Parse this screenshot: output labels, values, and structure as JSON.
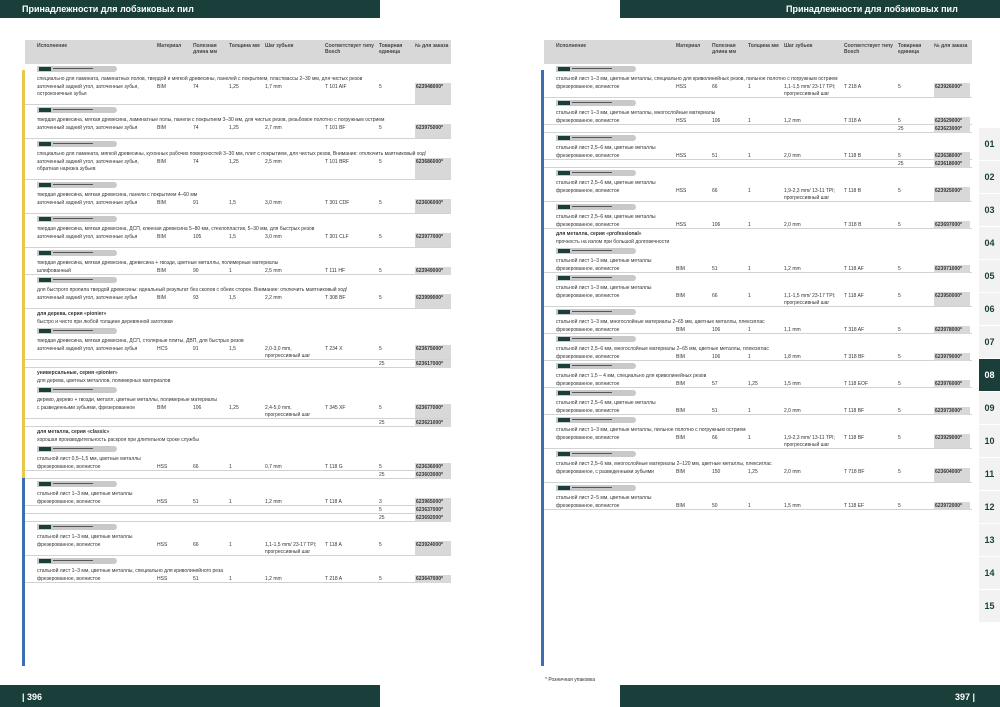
{
  "left": {
    "title": "Принадлежности для лобзиковых пил",
    "page_number": "| 396",
    "headers": [
      "Исполнение",
      "Материал",
      "Полезная длина мм",
      "Толщина мм",
      "Шаг зубьев",
      "Соответствует типу Bosch",
      "Товарная единица",
      "№ для заказа"
    ],
    "sections": [
      {
        "category": "",
        "desc": [
          "специально для ламината, ламинатных полов, твердой и мягкой древесины, панелей с покрытием, пластмассы 2–30 мм, для чистых резов"
        ],
        "rows": [
          [
            "заточенный задний угол, заточенные зубья, остроконечные зубья",
            "BIM",
            "74",
            "1,25",
            "1,7 mm",
            "T 101 AIF",
            "5",
            "623948000*"
          ]
        ]
      },
      {
        "category": "",
        "desc": [
          "твердая древесина, мягкая древесина, ламинатные полы, панели с покрытием 3–30 мм, для чистых резов, резьбовое полотно с погружным острием"
        ],
        "rows": [
          [
            "заточенный задний угол, заточенные зубья",
            "BIM",
            "74",
            "1,25",
            "2,7 mm",
            "T 101 BF",
            "5",
            "623975000*"
          ]
        ]
      },
      {
        "category": "",
        "desc": [
          "специально для ламината, мягкой древесины, кухонных рабочих поверхностей 3–30 мм, плит с покрытием, для чистых резов, Внимание: отключить маятниковый ход!"
        ],
        "rows": [
          [
            "заточенный задний угол, заточенные зубья, обратная нарезка зубьев",
            "BIM",
            "74",
            "1,25",
            "2,5 mm",
            "T 101 BRF",
            "5",
            "623686000*"
          ]
        ]
      },
      {
        "category": "",
        "desc": [
          "твердая древесина, мягкая древесина, панели с покрытием 4–60 мм"
        ],
        "rows": [
          [
            "заточенный задний угол, заточенные зубья",
            "BIM",
            "91",
            "1,5",
            "3,0 mm",
            "T 301 CDF",
            "5",
            "623606000*"
          ]
        ]
      },
      {
        "category": "",
        "desc": [
          "твердая древесина, мягкая древесина, ДСП, клееная древесина 5–80 мм, стеклопластик, 5–30 мм, для быстрых резов"
        ],
        "rows": [
          [
            "заточенный задний угол, заточенные зубья",
            "BIM",
            "105",
            "1,5",
            "3,0 mm",
            "T 301 CLF",
            "5",
            "623977000*"
          ]
        ]
      },
      {
        "category": "",
        "desc": [
          "твердая древесина, мягкая древесина, древесина + гвозди, цветные металлы, полимерные материалы"
        ],
        "rows": [
          [
            "шлифованный",
            "BIM",
            "90",
            "1",
            "2,5 mm",
            "T 111 HF",
            "5",
            "623949000*"
          ]
        ]
      },
      {
        "category": "",
        "desc": [
          "для быстрого пропила твердой древесины: идеальный результат без сколов с обеих сторон. Внимание: отключить маятниковый ход!"
        ],
        "rows": [
          [
            "заточенный задний угол, заточенные зубья",
            "BIM",
            "93",
            "1,5",
            "2,2 mm",
            "T 308 BF",
            "5",
            "623999000*"
          ]
        ]
      },
      {
        "category": "для дерева, серия «pionier»",
        "sub": "быстро и чисто при любой толщине деревянной заготовки",
        "desc": [
          "твердая древесина, мягкая древесина, ДСП, столярные плиты, ДВП, для быстрых резов"
        ],
        "rows": [
          [
            "заточенный задний угол, заточенные зубья",
            "HCS",
            "91",
            "1,5",
            "2,0-3,0 mm, прогрессивный шаг",
            "T 234 X",
            "5",
            "623675000*"
          ],
          [
            "",
            "",
            "",
            "",
            "",
            "",
            "25",
            "623617000*"
          ]
        ]
      },
      {
        "category": "универсальные, серия «pionier»",
        "sub": "для дерева, цветных металлов, полимерных материалов",
        "desc": [
          "дерево, дерево + гвозди, металл, цветные металлы, полимерные материалы"
        ],
        "rows": [
          [
            "с разведенными зубьями, фрезерованное",
            "BIM",
            "106",
            "1,25",
            "2,4-5,0 mm, прогрессивный шаг",
            "T 345 XF",
            "5",
            "623677000*"
          ],
          [
            "",
            "",
            "",
            "",
            "",
            "",
            "25",
            "623621000*"
          ]
        ]
      },
      {
        "category": "для металла, серия «classic»",
        "sub": "хорошая производительность раскроя при длительном сроке службы",
        "desc": [
          "стальной лист 0,5–1,5 мм, цветные металлы"
        ],
        "rows": [
          [
            "фрезерованное, волнистое",
            "HSS",
            "66",
            "1",
            "0,7 mm",
            "T 118 G",
            "5",
            "623636000*"
          ],
          [
            "",
            "",
            "",
            "",
            "",
            "",
            "25",
            "623603000*"
          ]
        ]
      },
      {
        "category": "",
        "desc": [
          "стальной лист 1–3 мм, цветные металлы"
        ],
        "rows": [
          [
            "фрезерованное, волнистое",
            "HSS",
            "51",
            "1",
            "1,2 mm",
            "T 118 A",
            "3",
            "623965000*"
          ],
          [
            "",
            "",
            "",
            "",
            "",
            "",
            "5",
            "623637000*"
          ],
          [
            "",
            "",
            "",
            "",
            "",
            "",
            "25",
            "623692000*"
          ]
        ]
      },
      {
        "category": "",
        "desc": [
          "стальной лист 1–3 мм, цветные металлы"
        ],
        "rows": [
          [
            "фрезерованное, волнистое",
            "HSS",
            "66",
            "1",
            "1,1-1,5 mm/ 23-17 TPI; прогрессивный шаг",
            "T 118 A",
            "5",
            "623924000*"
          ]
        ]
      },
      {
        "category": "",
        "desc": [
          "стальной лист 1–3 мм, цветные металлы, специально для криволинейного реза"
        ],
        "rows": [
          [
            "фрезерованное, волнистое",
            "HSS",
            "51",
            "1",
            "1,2 mm",
            "T 218 A",
            "5",
            "623647000*"
          ]
        ]
      }
    ]
  },
  "right": {
    "title": "Принадлежности для лобзиковых пил",
    "page_number": "397 |",
    "footnote": "* Розничная упаковка",
    "tabs": [
      "01",
      "02",
      "03",
      "04",
      "05",
      "06",
      "07",
      "08",
      "09",
      "10",
      "11",
      "12",
      "13",
      "14",
      "15"
    ],
    "active_tab": "08",
    "headers": [
      "Исполнение",
      "Материал",
      "Полезная длина мм",
      "Толщина мм",
      "Шаг зубьев",
      "Соответствует типу Bosch",
      "Товарная единица",
      "№ для заказа"
    ],
    "sections": [
      {
        "category": "",
        "desc": [
          "стальной лист 1–3 мм, цветные металлы, специально для криволинейных резов, пильное полотно с погружным острием"
        ],
        "rows": [
          [
            "фрезерованное, волнистое",
            "HSS",
            "66",
            "1",
            "1,1-1,5 mm/ 23-17 TPI; прогрессивный шаг",
            "T 218 A",
            "5",
            "623926000*"
          ]
        ]
      },
      {
        "category": "",
        "desc": [
          "стальной лист 1–3 мм, цветные металлы, многослойные материалы"
        ],
        "rows": [
          [
            "фрезерованное, волнистое",
            "HSS",
            "106",
            "1",
            "1,2 mm",
            "T 318 A",
            "5",
            "623629000*"
          ],
          [
            "",
            "",
            "",
            "",
            "",
            "",
            "25",
            "623623000*"
          ]
        ]
      },
      {
        "category": "",
        "desc": [
          "стальной лист 2,5–6 мм, цветные металлы"
        ],
        "rows": [
          [
            "фрезерованное, волнистое",
            "HSS",
            "51",
            "1",
            "2,0 mm",
            "T 118 B",
            "5",
            "623638000*"
          ],
          [
            "",
            "",
            "",
            "",
            "",
            "",
            "25",
            "623618000*"
          ]
        ]
      },
      {
        "category": "",
        "desc": [
          "стальной лист 2,5–6 мм, цветные металлы"
        ],
        "rows": [
          [
            "фрезерованное, волнистое",
            "HSS",
            "66",
            "1",
            "1,9-2,3 mm/ 13-11 TPI; прогрессивный шаг",
            "T 118 B",
            "5",
            "623925000*"
          ]
        ]
      },
      {
        "category": "",
        "desc": [
          "стальной лист 2,5–6 мм, цветные металлы"
        ],
        "rows": [
          [
            "фрезерованное, волнистое",
            "HSS",
            "106",
            "1",
            "2,0 mm",
            "T 318 B",
            "5",
            "623697000*"
          ]
        ]
      },
      {
        "category": "для металла, серия «professional»",
        "sub": "прочность на излом при большой долговечности",
        "desc": [
          "стальной лист 1–3 мм, цветные металлы"
        ],
        "rows": [
          [
            "фрезерованное, волнистое",
            "BIM",
            "51",
            "1",
            "1,2 mm",
            "T 118 AF",
            "5",
            "623971000*"
          ]
        ]
      },
      {
        "category": "",
        "desc": [
          "стальной лист 1–3 мм, цветные металлы"
        ],
        "rows": [
          [
            "фрезерованное, волнистое",
            "BIM",
            "66",
            "1",
            "1,1-1,5 mm/ 23-17 TPI; прогрессивный шаг",
            "T 118 AF",
            "5",
            "623950000*"
          ]
        ]
      },
      {
        "category": "",
        "desc": [
          "стальной лист 1–3 мм, многослойные материалы 2–65 мм, цветные металлы, плексиглас"
        ],
        "rows": [
          [
            "фрезерованное, волнистое",
            "BIM",
            "106",
            "1",
            "1,1 mm",
            "T 318 AF",
            "5",
            "623978000*"
          ]
        ]
      },
      {
        "category": "",
        "desc": [
          "стальной лист 2,5–6 мм, многослойные материалы 2–65 мм, цветные металлы, плексиглас"
        ],
        "rows": [
          [
            "фрезерованное, волнистое",
            "BIM",
            "106",
            "1",
            "1,8 mm",
            "T 318 BF",
            "5",
            "623979000*"
          ]
        ]
      },
      {
        "category": "",
        "desc": [
          "стальной лист 1,5 – 4 мм, специально для криволинейных резов"
        ],
        "rows": [
          [
            "фрезерованное, волнистое",
            "BIM",
            "57",
            "1,25",
            "1,5 mm",
            "T 118 EOF",
            "5",
            "623976000*"
          ]
        ]
      },
      {
        "category": "",
        "desc": [
          "стальной лист 2,5–6 мм, цветные металлы"
        ],
        "rows": [
          [
            "фрезерованное, волнистое",
            "BIM",
            "51",
            "1",
            "2,0 mm",
            "T 118 BF",
            "5",
            "623973000*"
          ]
        ]
      },
      {
        "category": "",
        "desc": [
          "стальной лист 1–3 мм, цветные металлы, пильное полотно с погружным острием"
        ],
        "rows": [
          [
            "фрезерованное, волнистое",
            "BIM",
            "66",
            "1",
            "1,9-2,3 mm/ 13-11 TPI; прогрессивный шаг",
            "T 118 BF",
            "5",
            "623929000*"
          ]
        ]
      },
      {
        "category": "",
        "desc": [
          "стальной лист 2,5–6 мм, многослойные материалы 2–120 мм, цветные металлы, плексиглас"
        ],
        "rows": [
          [
            "фрезерованное, с разведенными зубьями",
            "BIM",
            "150",
            "1,25",
            "2,0 mm",
            "T 718 BF",
            "5",
            "623604000*"
          ]
        ]
      },
      {
        "category": "",
        "desc": [
          "стальной лист 2–5 мм, цветные металлы"
        ],
        "rows": [
          [
            "фрезерованное, волнистое",
            "BIM",
            "50",
            "1",
            "1,5 mm",
            "T 118 EF",
            "5",
            "623972000*"
          ]
        ]
      }
    ]
  }
}
